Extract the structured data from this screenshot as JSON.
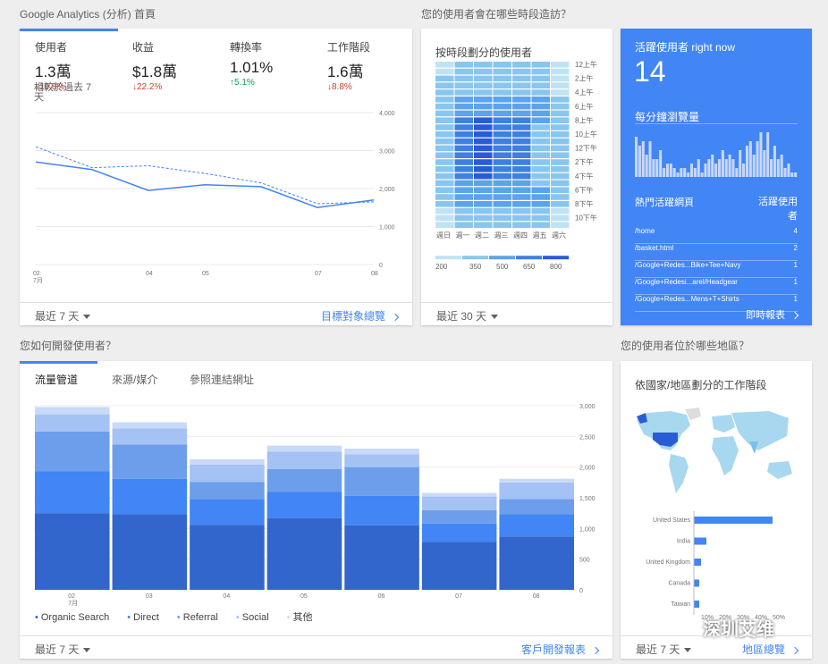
{
  "titles": {
    "home": "Google Analytics (分析) 首頁",
    "when": "您的使用者會在哪些時段造訪？",
    "acquire": "您如何開發使用者？",
    "where": "您的使用者位於哪些地區？"
  },
  "overview": {
    "metrics": [
      {
        "label": "使用者",
        "value": "1.3萬",
        "change": "↓10.8%",
        "dir": "down"
      },
      {
        "label": "收益",
        "value": "$1.8萬",
        "change": "↓22.2%",
        "dir": "down"
      },
      {
        "label": "轉換率",
        "value": "1.01%",
        "change": "↑5.1%",
        "dir": "up"
      },
      {
        "label": "工作階段",
        "value": "1.6萬",
        "change": "↓8.8%",
        "dir": "down"
      }
    ],
    "compare_note": "相較於過去 7 天",
    "range": "最近 7 天",
    "link": "目標對象總覽"
  },
  "chart_data": [
    {
      "type": "line",
      "x": [
        "02",
        "03",
        "04",
        "05",
        "06",
        "07",
        "08"
      ],
      "x_tick_labels": [
        "02\n7月",
        "04",
        "05",
        "07",
        "08"
      ],
      "series": [
        {
          "values": [
            2700,
            2500,
            1950,
            2100,
            2050,
            1500,
            1700
          ]
        },
        {
          "values": [
            3100,
            2550,
            2600,
            2400,
            2150,
            1600,
            1650
          ],
          "style": "dashed"
        }
      ],
      "ylim": [
        0,
        4000
      ],
      "y_ticks": [
        "4,000",
        "3,000",
        "2,000",
        "1,000",
        "0"
      ]
    },
    {
      "type": "bar",
      "stacked": true,
      "categories": [
        "02\n7月",
        "03",
        "04",
        "05",
        "06",
        "07",
        "08"
      ],
      "series": [
        {
          "name": "Organic Search",
          "values": [
            1250,
            1230,
            1060,
            1170,
            1050,
            780,
            870
          ],
          "color": "#3366cc"
        },
        {
          "name": "Direct",
          "values": [
            680,
            580,
            420,
            430,
            480,
            300,
            360
          ],
          "color": "#4285f4"
        },
        {
          "name": "Referral",
          "values": [
            650,
            560,
            280,
            370,
            470,
            220,
            250
          ],
          "color": "#6d9eeb"
        },
        {
          "name": "Social",
          "values": [
            280,
            260,
            280,
            280,
            210,
            220,
            270
          ],
          "color": "#a4c2f4"
        },
        {
          "name": "其他",
          "values": [
            120,
            100,
            90,
            100,
            90,
            60,
            60
          ],
          "color": "#c9daf8"
        }
      ],
      "ylim": [
        0,
        3000
      ],
      "y_ticks": [
        "3,000",
        "2,500",
        "2,000",
        "1,500",
        "1,000",
        "500",
        "0"
      ]
    },
    {
      "type": "bar",
      "orientation": "horizontal",
      "categories": [
        "United States",
        "India",
        "United Kingdom",
        "Canada",
        "Taiwan"
      ],
      "values": [
        44,
        7,
        4,
        3,
        3
      ],
      "x_ticks": [
        "10%",
        "20%",
        "30%",
        "40%",
        "50%"
      ]
    }
  ],
  "heatmap": {
    "title": "按時段劃分的使用者",
    "days": [
      "週日",
      "週一",
      "週二",
      "週三",
      "週四",
      "週五",
      "週六"
    ],
    "hours": [
      "12上午",
      "2上午",
      "4上午",
      "6上午",
      "8上午",
      "10上午",
      "12下午",
      "2下午",
      "4下午",
      "6下午",
      "8下午",
      "10下午"
    ],
    "legend": [
      "200",
      "350",
      "500",
      "650",
      "800"
    ],
    "range": "最近 30 天"
  },
  "realtime": {
    "title": "活躍使用者 right now",
    "count": "14",
    "pageviews_label": "每分鐘瀏覽量",
    "pages_header": "熱門活躍網頁",
    "users_header": "活躍使用者",
    "pages": [
      {
        "path": "/home",
        "n": "4"
      },
      {
        "path": "/basket.html",
        "n": "2"
      },
      {
        "path": "/Google+Redes...Bike+Tee+Navy",
        "n": "1"
      },
      {
        "path": "/Google+Redesi...arel/Headgear",
        "n": "1"
      },
      {
        "path": "/Google+Redes...Mens+T+Shirts",
        "n": "1"
      }
    ],
    "link": "即時報表",
    "pageviews": [
      9,
      7,
      8,
      5,
      8,
      4,
      4,
      6,
      2,
      3,
      3,
      2,
      1,
      2,
      2,
      1,
      3,
      2,
      4,
      1,
      3,
      4,
      5,
      3,
      4,
      6,
      4,
      5,
      4,
      2,
      6,
      3,
      7,
      8,
      5,
      8,
      10,
      6,
      10,
      4,
      7,
      4,
      5,
      2,
      3,
      1,
      1
    ]
  },
  "acquisition": {
    "tabs": [
      "流量管道",
      "來源/媒介",
      "參照連結網址"
    ],
    "range": "最近 7 天",
    "link": "客戶開發報表"
  },
  "geo": {
    "title": "依國家/地區劃分的工作階段",
    "range": "最近 7 天",
    "link": "地區總覽",
    "watermark": "深圳艾维"
  },
  "colors": {
    "accent": "#4285f4",
    "realtime_bg": "#4285f4",
    "down": "#d23f31",
    "up": "#0f9d58"
  }
}
